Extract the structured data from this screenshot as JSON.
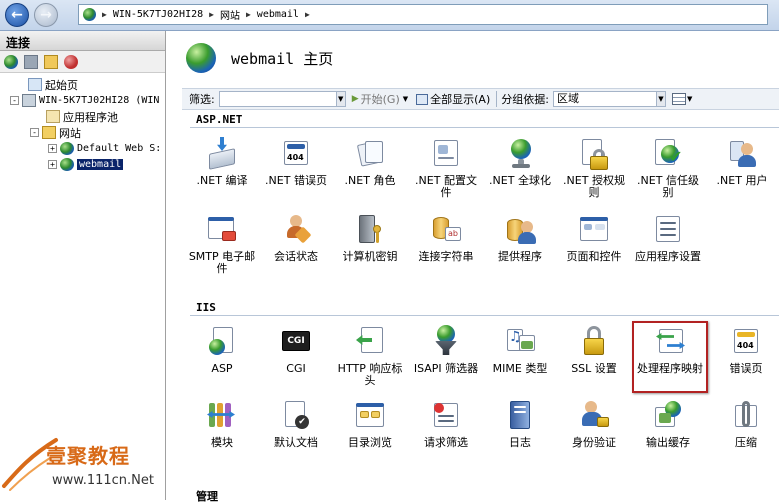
{
  "address_bar": {
    "crumbs": [
      "WIN-5K7TJ02HI28",
      "网站",
      "webmail"
    ]
  },
  "left_panel": {
    "header": "连接",
    "tree": {
      "start_page": "起始页",
      "server": "WIN-5K7TJ02HI28 (WIN",
      "app_pools": "应用程序池",
      "sites": "网站",
      "default_site": "Default Web S:",
      "webmail": "webmail"
    }
  },
  "main": {
    "title": "webmail 主页",
    "filter": {
      "label": "筛选:",
      "placeholder": "",
      "start_label": "开始(G)",
      "show_all_label": "全部显示(A)",
      "group_by_label": "分组依据:",
      "group_by_value": "区域"
    },
    "sections": {
      "aspnet": "ASP.NET",
      "iis": "IIS",
      "management": "管理"
    },
    "aspnet_features": [
      {
        "label": ".NET 编译",
        "icon": "compile-icon"
      },
      {
        "label": ".NET 错误页",
        "icon": "error-page-icon"
      },
      {
        "label": ".NET 角色",
        "icon": "roles-icon"
      },
      {
        "label": ".NET 配置文件",
        "icon": "profile-icon"
      },
      {
        "label": ".NET 全球化",
        "icon": "globalization-icon"
      },
      {
        "label": ".NET 授权规则",
        "icon": "authorization-icon"
      },
      {
        "label": ".NET 信任级别",
        "icon": "trust-level-icon"
      },
      {
        "label": ".NET 用户",
        "icon": "users-icon"
      },
      {
        "label": "SMTP 电子邮件",
        "icon": "smtp-icon"
      },
      {
        "label": "会话状态",
        "icon": "session-state-icon"
      },
      {
        "label": "计算机密钥",
        "icon": "machine-key-icon"
      },
      {
        "label": "连接字符串",
        "icon": "connection-string-icon"
      },
      {
        "label": "提供程序",
        "icon": "providers-icon"
      },
      {
        "label": "页面和控件",
        "icon": "pages-controls-icon"
      },
      {
        "label": "应用程序设置",
        "icon": "app-settings-icon"
      }
    ],
    "iis_features": [
      {
        "label": "ASP",
        "icon": "asp-icon"
      },
      {
        "label": "CGI",
        "icon": "cgi-icon"
      },
      {
        "label": "HTTP 响应标头",
        "icon": "http-headers-icon"
      },
      {
        "label": "ISAPI 筛选器",
        "icon": "isapi-filters-icon"
      },
      {
        "label": "MIME 类型",
        "icon": "mime-types-icon"
      },
      {
        "label": "SSL 设置",
        "icon": "ssl-icon"
      },
      {
        "label": "处理程序映射",
        "icon": "handler-mappings-icon"
      },
      {
        "label": "错误页",
        "icon": "error-pages-icon"
      },
      {
        "label": "模块",
        "icon": "modules-icon"
      },
      {
        "label": "默认文档",
        "icon": "default-document-icon"
      },
      {
        "label": "目录浏览",
        "icon": "directory-browsing-icon"
      },
      {
        "label": "请求筛选",
        "icon": "request-filtering-icon"
      },
      {
        "label": "日志",
        "icon": "logging-icon"
      },
      {
        "label": "身份验证",
        "icon": "authentication-icon"
      },
      {
        "label": "输出缓存",
        "icon": "output-caching-icon"
      },
      {
        "label": "压缩",
        "icon": "compression-icon"
      }
    ]
  },
  "watermark": {
    "brand": "壹聚教程",
    "url": "www.111cn.Net"
  }
}
